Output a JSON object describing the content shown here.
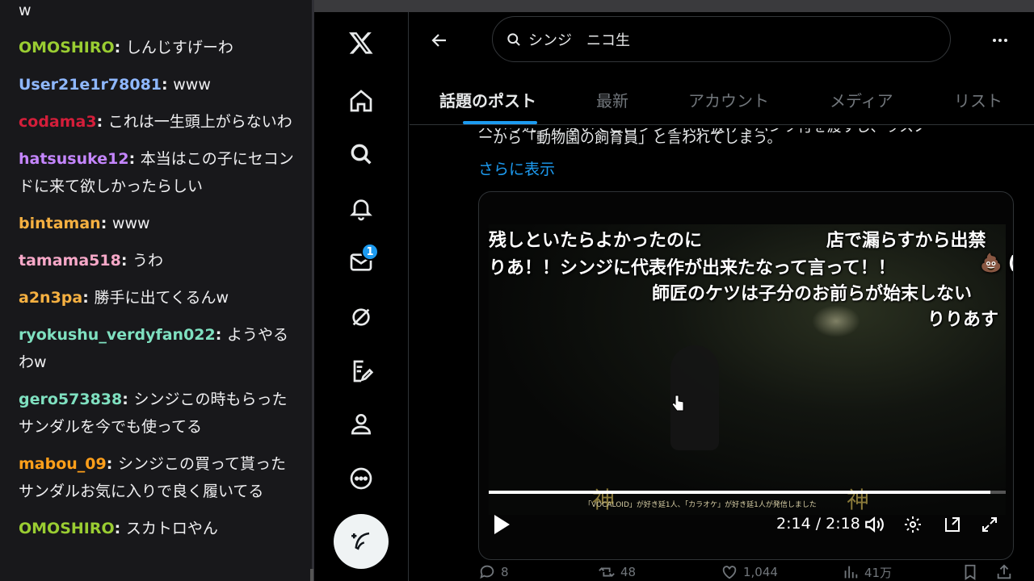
{
  "chat": {
    "messages": [
      {
        "user": "",
        "text": "w",
        "color": "#efeff1"
      },
      {
        "user": "OMOSHIRO",
        "text": "しんじすげーわ",
        "color": "#9acd32"
      },
      {
        "user": "User21e1r78081",
        "text": "www",
        "color": "#8fb8ff"
      },
      {
        "user": "codama3",
        "text": "これは一生頭上がらないわ",
        "color": "#d41e3a"
      },
      {
        "user": "hatsusuke12",
        "text": "本当はこの子にセコンドに来て欲しかったらしい",
        "color": "#c586ff"
      },
      {
        "user": "bintaman",
        "text": "www",
        "color": "#f5b041"
      },
      {
        "user": "tamama518",
        "text": "うわ",
        "color": "#f7a8c8"
      },
      {
        "user": "a2n3pa",
        "text": "勝手に出てくるんw",
        "color": "#f5b041"
      },
      {
        "user": "ryokushu_verdyfan022",
        "text": "ようやるわw",
        "color": "#7fe0c0"
      },
      {
        "user": "gero573838",
        "text": "シンジこの時もらったサンダルを今でも使ってる",
        "color": "#7fe0c0"
      },
      {
        "user": "mabou_09",
        "text": "シンジこの買って貰ったサンダルお気に入りで良く履いてる",
        "color": "#ff9f1a"
      },
      {
        "user": "OMOSHIRO",
        "text": "スカトロやん",
        "color": "#9acd32"
      }
    ]
  },
  "nav": {
    "items": [
      "x-logo",
      "home",
      "explore",
      "notifications",
      "messages",
      "grok",
      "premium",
      "profile",
      "more"
    ],
    "messages_badge": "1"
  },
  "header": {
    "search_value": "シンジ　ニコ生"
  },
  "tabs": [
    "話題のポスト",
    "最新",
    "アカウント",
    "メディア",
    "リスト"
  ],
  "tweet": {
    "partial_line": "ーから「動物園の飼育員」と言われてしまう。",
    "partial_top": "大いら近づかないてこ白シンジ氏に扱けてハンツ付を渡すし、ラスノ",
    "show_more": "さらに表示"
  },
  "video": {
    "overlays": [
      "残しといたらよかったのに",
      "店で漏らすから出禁",
      "りあ！！シンジに代表作が出来たなって言って！！",
      "💩 (",
      "師匠のケツは子分のお前らが始末しない",
      "りりあす"
    ],
    "caption_strip": "「VOCALOID」が好き延1人、「カラオケ」が好き延1人が発信しました",
    "kami": "神",
    "time": "2:14 / 2:18",
    "progress": 0.97
  },
  "actions": {
    "replies": "8",
    "reposts": "48",
    "likes": "1,044",
    "views": "41万"
  }
}
